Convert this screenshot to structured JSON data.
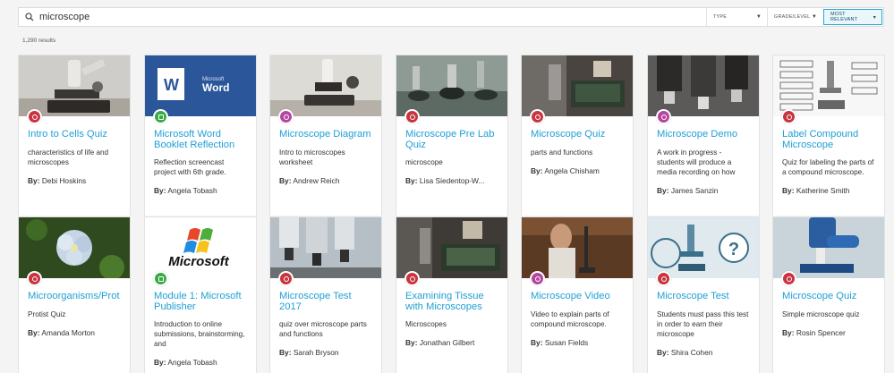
{
  "search": {
    "value": "microscope"
  },
  "filters": {
    "type": "TYPE",
    "grade": "GRADE/LEVEL",
    "sort": "MOST RELEVANT"
  },
  "results_count": "1,290 results",
  "by_label": "By:",
  "colors": {
    "quiz": "#c8343f",
    "doc": "#3aaa48",
    "lesson": "#b446a0",
    "link": "#1f9fd5"
  },
  "row1": [
    {
      "title": "Intro to Cells Quiz",
      "desc": "characteristics of life and microscopes",
      "author": "Debi Hoskins",
      "type": "quiz"
    },
    {
      "title": "Microsoft Word Booklet Reflection",
      "desc": "Reflection screencast project with 6th grade.",
      "author": "Angela Tobash",
      "type": "doc"
    },
    {
      "title": "Microscope Diagram",
      "desc": "Intro to microscopes worksheet",
      "author": "Andrew Reich",
      "type": "lesson"
    },
    {
      "title": "Microscope Pre Lab Quiz",
      "desc": "microscope",
      "author": "Lisa Siedentop-W...",
      "type": "quiz"
    },
    {
      "title": "Microscope Quiz",
      "desc": "parts and functions",
      "author": "Angela Chisham",
      "type": "quiz"
    },
    {
      "title": "Microscope Demo",
      "desc": "A work in progress - students will produce a media recording on how",
      "author": "James Sanzin",
      "type": "lesson"
    },
    {
      "title": "Label Compound Microscope",
      "desc": "Quiz for labeling the parts of a compound microscope.",
      "author": "Katherine Smith",
      "type": "quiz"
    }
  ],
  "row2": [
    {
      "title": "Microorganisms/Prot Quiz",
      "desc": "Protist Quiz",
      "author": "Amanda Morton",
      "type": "quiz"
    },
    {
      "title": "Module 1: Microsoft Publisher",
      "desc": "Introduction to online submissions, brainstorming, and",
      "author": "Angela Tobash",
      "type": "doc"
    },
    {
      "title": "Microscope Test 2017",
      "desc": "quiz over microscope parts and functions",
      "author": "Sarah Bryson",
      "type": "quiz"
    },
    {
      "title": "Examining Tissue with Microscopes",
      "desc": "Microscopes",
      "author": "Jonathan Gilbert",
      "type": "quiz"
    },
    {
      "title": "Microscope Video",
      "desc": "Video to explain parts of compound microscope.",
      "author": "Susan Fields",
      "type": "lesson"
    },
    {
      "title": "Microscope Test",
      "desc": "Students must pass this test in order to earn their microscope",
      "author": "Shira Cohen",
      "type": "quiz"
    },
    {
      "title": "Microscope Quiz",
      "desc": "Simple microscope quiz",
      "author": "Rosin Spencer",
      "type": "quiz"
    }
  ],
  "thumb_text": {
    "word_brand": "Microsoft",
    "word_product": "Word",
    "ms_logo": "Microsoft",
    "word_letter": "W",
    "question_mark": "?"
  }
}
